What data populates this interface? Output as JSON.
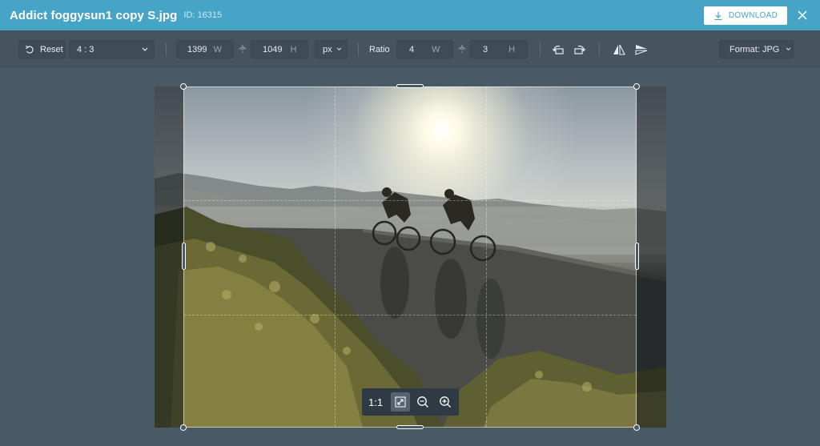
{
  "header": {
    "title": "Addict foggysun1 copy S.jpg",
    "image_id": "ID: 16315",
    "download_label": "DOWNLOAD",
    "accent_color": "#46a4c6"
  },
  "toolbar": {
    "reset_label": "Reset",
    "aspect_select": "4 : 3",
    "width_value": "1399",
    "width_unit": "W",
    "height_value": "1049",
    "height_unit": "H",
    "size_unit": "px",
    "ratio_label": "Ratio",
    "ratio_w_value": "4",
    "ratio_w_unit": "W",
    "ratio_h_value": "3",
    "ratio_h_unit": "H",
    "format_label": "Format: JPG"
  },
  "zoom": {
    "actual_size_label": "1:1"
  },
  "icons": {
    "reset": "undo-icon",
    "aspect_dropdown": "chevron-down-icon",
    "lock_dimensions": "link-icon",
    "rotate_left": "rotate-left-icon",
    "rotate_right": "rotate-right-icon",
    "flip_horizontal": "flip-horizontal-icon",
    "flip_vertical": "flip-vertical-icon",
    "download": "download-icon",
    "close": "close-icon",
    "fit": "fit-screen-icon",
    "zoom_out": "zoom-out-icon",
    "zoom_in": "zoom-in-icon"
  }
}
